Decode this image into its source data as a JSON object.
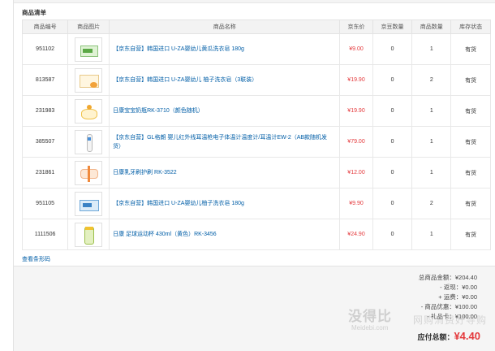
{
  "section_title": "商品清单",
  "columns": [
    "商品编号",
    "商品图片",
    "商品名称",
    "京东价",
    "京豆数量",
    "商品数量",
    "库存状态"
  ],
  "items": [
    {
      "id": "951102",
      "name": "【京东自营】韩国进口 U-ZA婴幼儿黄瓜洗衣皂 180g",
      "price": "¥9.00",
      "beans": "0",
      "qty": "1",
      "stock": "有货",
      "thumb": "green-box"
    },
    {
      "id": "813587",
      "name": "【京东自营】韩国进口 U-ZA婴幼儿 柚子洗衣皂（3联装）",
      "price": "¥19.90",
      "beans": "0",
      "qty": "2",
      "stock": "有货",
      "thumb": "soap-pack"
    },
    {
      "id": "231983",
      "name": "日康宝宝奶瓶RK-3710（颜色随机）",
      "price": "¥19.90",
      "beans": "0",
      "qty": "1",
      "stock": "有货",
      "thumb": "bottle"
    },
    {
      "id": "385507",
      "name": "【京东自营】GL格朗 婴儿红外线耳温枪电子体温计温度计/耳温计EW-2（AB款随机发货）",
      "price": "¥79.00",
      "beans": "0",
      "qty": "1",
      "stock": "有货",
      "thumb": "thermometer"
    },
    {
      "id": "231861",
      "name": "日康乳牙刷护刷 RK-3522",
      "price": "¥12.00",
      "beans": "0",
      "qty": "1",
      "stock": "有货",
      "thumb": "toothbrush"
    },
    {
      "id": "951105",
      "name": "【京东自营】韩国进口 U-ZA婴幼儿柚子洗衣皂 180g",
      "price": "¥9.90",
      "beans": "0",
      "qty": "2",
      "stock": "有货",
      "thumb": "blue-box"
    },
    {
      "id": "1111506",
      "name": "日康 足球运动杯 430ml（黄色）RK-3456",
      "price": "¥24.90",
      "beans": "0",
      "qty": "1",
      "stock": "有货",
      "thumb": "cup"
    }
  ],
  "link_text": "查看条形码",
  "summary": {
    "goods_total": "总商品金额：¥204.40",
    "rebate": "- 返现：¥0.00",
    "shipping": "+ 运费：¥0.00",
    "discount": "- 商品优惠：¥100.00",
    "gift_card": "- 礼品卡：¥100.00",
    "total_label": "应付总额：",
    "total_amount": "¥4.40"
  },
  "watermark": {
    "cn": "没得比",
    "en": "Meidebi.com",
    "sub": "网购消费好导购"
  },
  "colors": {
    "price": "#e4393c",
    "link": "#005ea7",
    "header_bg": "#f3f3f3",
    "summary_bg": "#f5f5f5"
  }
}
